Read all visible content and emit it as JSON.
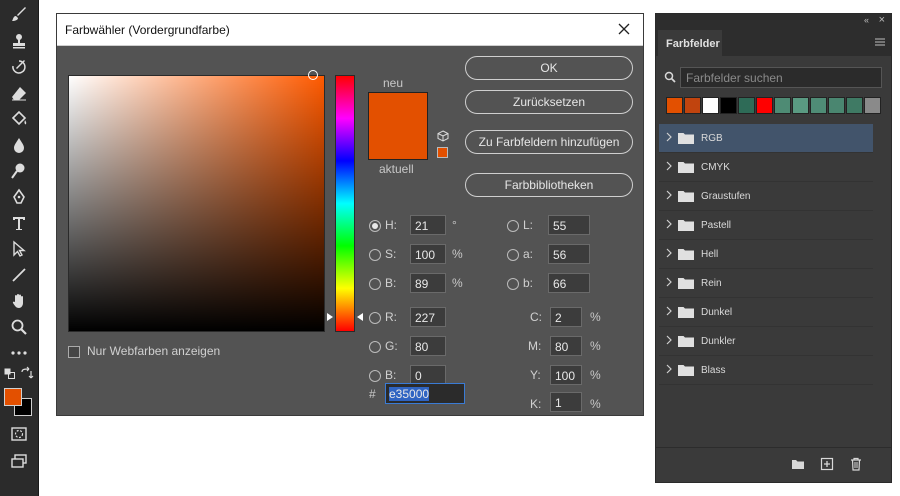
{
  "dialog": {
    "title": "Farbwähler (Vordergrundfarbe)",
    "labels": {
      "new": "neu",
      "current": "aktuell",
      "hash": "#"
    },
    "buttons": {
      "ok": "OK",
      "reset": "Zurücksetzen",
      "add_to_swatches": "Zu Farbfeldern hinzufügen",
      "libraries": "Farbbibliotheken"
    },
    "web_only": {
      "label": "Nur Webfarben anzeigen",
      "checked": false
    },
    "hue_position": 0.943,
    "fields": {
      "H": {
        "label": "H:",
        "value": "21",
        "unit": "°"
      },
      "S": {
        "label": "S:",
        "value": "100",
        "unit": "%"
      },
      "Bv": {
        "label": "B:",
        "value": "89",
        "unit": "%"
      },
      "R": {
        "label": "R:",
        "value": "227"
      },
      "G": {
        "label": "G:",
        "value": "80"
      },
      "Bb": {
        "label": "B:",
        "value": "0"
      },
      "L": {
        "label": "L:",
        "value": "55"
      },
      "a": {
        "label": "a:",
        "value": "56"
      },
      "b": {
        "label": "b:",
        "value": "66"
      },
      "C": {
        "label": "C:",
        "value": "2",
        "unit": "%"
      },
      "M": {
        "label": "M:",
        "value": "80",
        "unit": "%"
      },
      "Y": {
        "label": "Y:",
        "value": "100",
        "unit": "%"
      },
      "K": {
        "label": "K:",
        "value": "1",
        "unit": "%"
      }
    },
    "hex": "e35000",
    "current_color": "#e35000"
  },
  "panel": {
    "collapse": "«",
    "close": "×",
    "tab": "Farbfelder",
    "search_placeholder": "Farbfelder suchen",
    "recent_colors": [
      "#e35000",
      "#c1440e",
      "#ffffff",
      "#000000",
      "#2e6b57",
      "#ff0000",
      "#4e8b74",
      "#5a9a82",
      "#4f8c76",
      "#4a8670",
      "#3f7a64",
      "#8a8a8a"
    ],
    "groups": [
      {
        "label": "RGB",
        "selected": true
      },
      {
        "label": "CMYK"
      },
      {
        "label": "Graustufen"
      },
      {
        "label": "Pastell"
      },
      {
        "label": "Hell"
      },
      {
        "label": "Rein"
      },
      {
        "label": "Dunkel"
      },
      {
        "label": "Dunkler"
      },
      {
        "label": "Blass"
      }
    ]
  },
  "toolbar": {
    "foreground_color": "#e35000",
    "background_color": "#000000",
    "tools": [
      "brush-icon",
      "stamp-icon",
      "history-brush-icon",
      "eraser-icon",
      "paint-bucket-icon",
      "blur-icon",
      "dodge-icon",
      "pen-icon",
      "type-icon",
      "path-select-icon",
      "line-icon",
      "hand-icon",
      "zoom-icon",
      "more-icon"
    ]
  }
}
